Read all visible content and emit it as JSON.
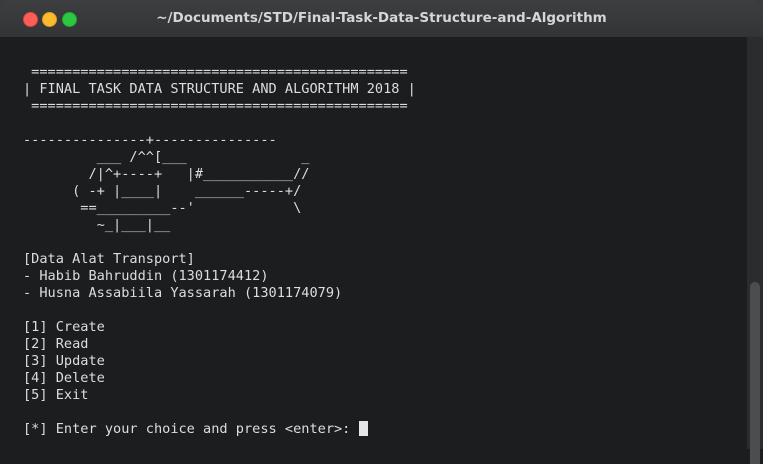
{
  "window": {
    "title": "~/Documents/STD/Final-Task-Data-Structure-and-Algorithm"
  },
  "terminal": {
    "lines": [
      "",
      " ==============================================",
      "| FINAL TASK DATA STRUCTURE AND ALGORITHM 2018 |",
      " ==============================================",
      "",
      "---------------+---------------",
      "         ___ /^^[___              _",
      "        /|^+----+   |#___________//",
      "      ( -+ |____|    ______-----+/",
      "       ==_________--'            \\",
      "         ~_|___|__",
      "",
      "[Data Alat Transport]",
      "- Habib Bahruddin (1301174412)",
      "- Husna Assabiila Yassarah (1301174079)",
      "",
      "[1] Create",
      "[2] Read",
      "[3] Update",
      "[4] Delete",
      "[5] Exit",
      ""
    ],
    "prompt": "[*] Enter your choice and press <enter>: "
  }
}
